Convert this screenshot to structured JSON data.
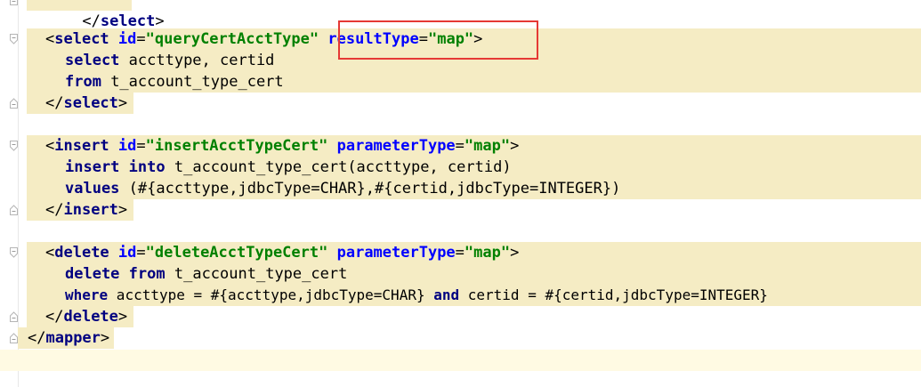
{
  "lines": [
    {
      "id": "l0",
      "text": "</select>"
    },
    {
      "id": "l1",
      "open": "<",
      "tag": "select",
      "attrs": [
        {
          "name": "id",
          "value": "\"queryCertAcctType\""
        },
        {
          "name": "resultType",
          "value": "\"map\""
        }
      ],
      "close": ">"
    },
    {
      "id": "l2",
      "kw1": "select",
      "rest": " accttype, certid"
    },
    {
      "id": "l3",
      "kw1": "from",
      "rest": " t_account_type_cert"
    },
    {
      "id": "l4",
      "endtag": "select"
    },
    {
      "id": "l5",
      "open": "<",
      "tag": "insert",
      "attrs": [
        {
          "name": "id",
          "value": "\"insertAcctTypeCert\""
        },
        {
          "name": "parameterType",
          "value": "\"map\""
        }
      ],
      "close": ">"
    },
    {
      "id": "l6",
      "kw1": "insert",
      "kw2": "into",
      "rest": " t_account_type_cert(accttype, certid)"
    },
    {
      "id": "l7",
      "kw1": "values",
      "rest": " (#{accttype,jdbcType=CHAR},#{certid,jdbcType=INTEGER})"
    },
    {
      "id": "l8",
      "endtag": "insert"
    },
    {
      "id": "l9",
      "open": "<",
      "tag": "delete",
      "attrs": [
        {
          "name": "id",
          "value": "\"deleteAcctTypeCert\""
        },
        {
          "name": "parameterType",
          "value": "\"map\""
        }
      ],
      "close": ">"
    },
    {
      "id": "l10",
      "kw1": "delete",
      "kw2": "from",
      "rest": " t_account_type_cert"
    },
    {
      "id": "l11",
      "kw1": "where",
      "rest": " accttype = #{accttype,jdbcType=CHAR} ",
      "kw3": "and",
      "rest2": " certid = #{certid,jdbcType=INTEGER}"
    },
    {
      "id": "l12",
      "endtag": "delete"
    },
    {
      "id": "l13",
      "endtag": "mapper"
    }
  ],
  "colors": {
    "highlight_box": "#e53935",
    "block_background": "#f5ecc4",
    "tag": "#000080",
    "attribute": "#0000ff",
    "value": "#008000"
  },
  "fold_icons": [
    "fold-marker-icon"
  ]
}
